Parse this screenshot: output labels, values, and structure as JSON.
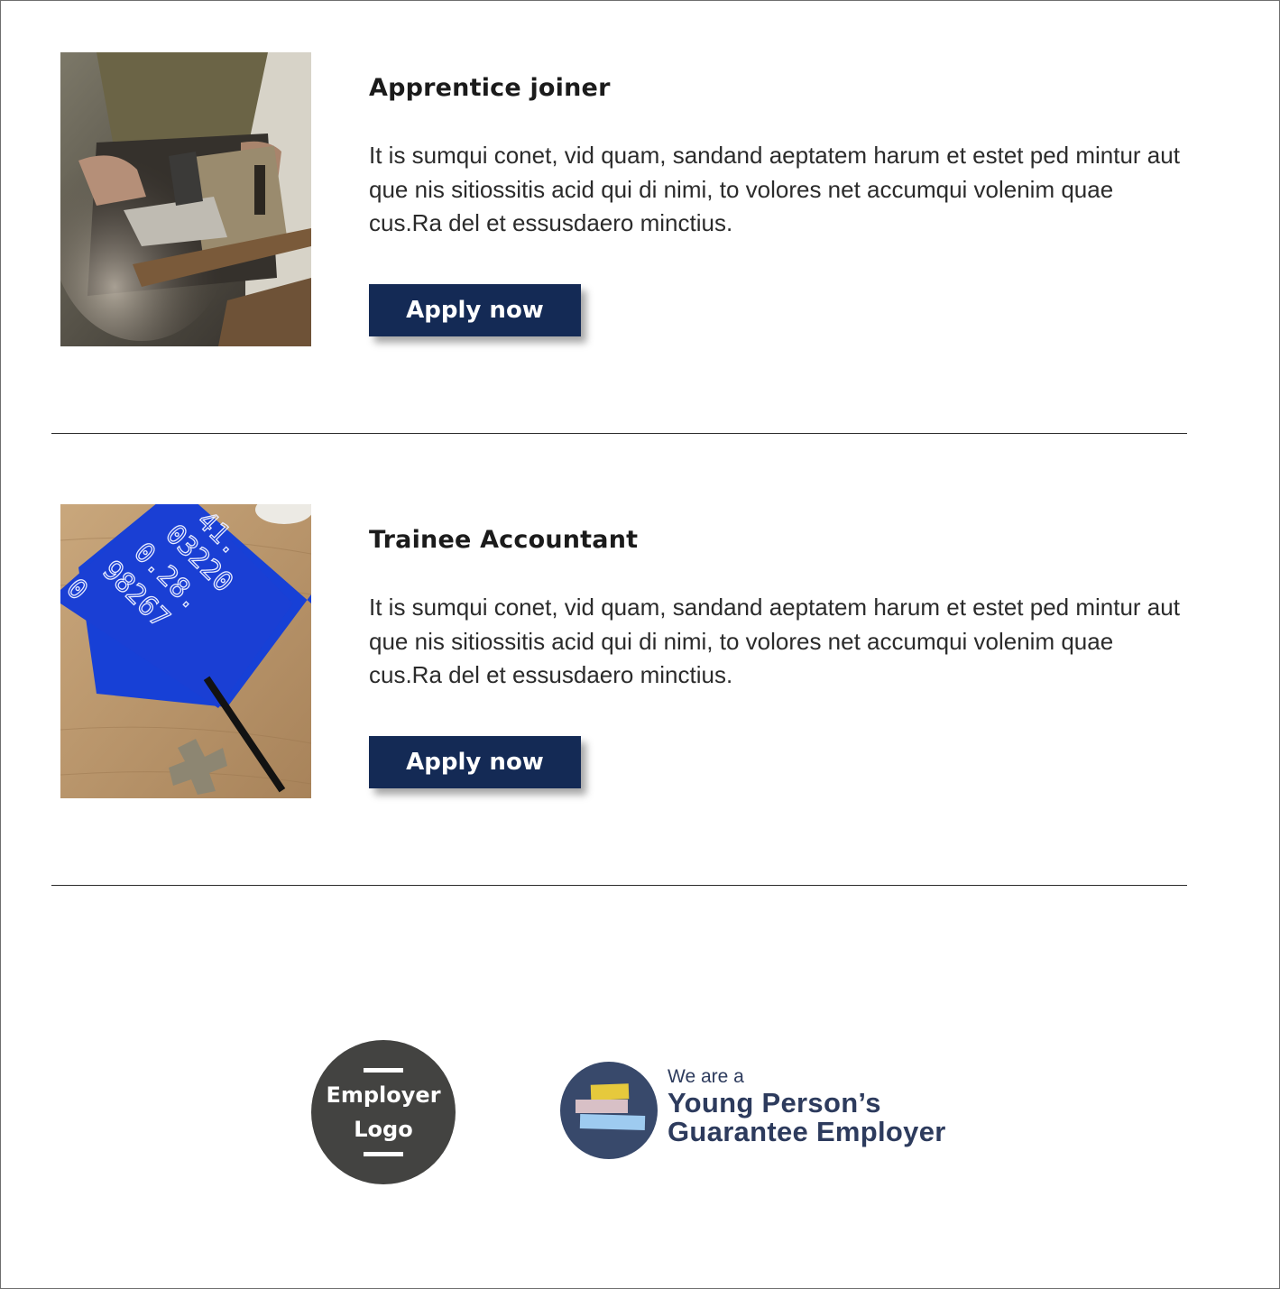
{
  "jobs": [
    {
      "title": "Apprentice joiner",
      "description": "It is sumqui conet, vid quam, sandand aeptatem harum et estet ped mintur aut que nis sitiossitis acid qui di nimi, to volores net accumqui volenim quae cus.Ra del et essusdaero minctius.",
      "apply_label": "Apply now"
    },
    {
      "title": "Trainee Accountant",
      "description": "It is sumqui conet, vid quam, sandand aeptatem harum et estet ped mintur aut que nis sitiossitis acid qui di nimi, to volores net accumqui volenim quae cus.Ra del et essusdaero minctius.",
      "apply_label": "Apply now",
      "notebook_digits": [
        "41.",
        "03220",
        "0.28.",
        "98267",
        "0"
      ]
    }
  ],
  "footer": {
    "employer_logo_line1": "Employer",
    "employer_logo_line2": "Logo",
    "ypg_small": "We are a",
    "ypg_line1": "Young Person’s",
    "ypg_line2": "Guarantee Employer"
  },
  "colors": {
    "button": "#142a55",
    "employer_logo_bg": "#434341",
    "ypg_navy": "#2d3b5d",
    "ypg_yellow": "#e6c93c",
    "ypg_pink": "#d8c0c6",
    "ypg_blue": "#9ecbf0"
  }
}
